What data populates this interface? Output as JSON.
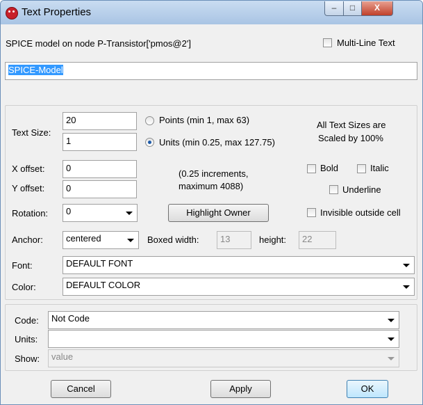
{
  "window": {
    "title": "Text Properties"
  },
  "titlebar": {
    "minimize": "–",
    "maximize": "□",
    "close": "X"
  },
  "header": {
    "description": "SPICE model on node P-Transistor['pmos@2']",
    "multiline_label": "Multi-Line Text"
  },
  "text_value": "SPICE-Model",
  "size": {
    "label": "Text Size:",
    "points_value": "20",
    "units_value": "1",
    "points_label": "Points (min 1, max 63)",
    "units_label": "Units (min 0.25, max 127.75)",
    "note_line1": "All Text Sizes are",
    "note_line2": "Scaled by 100%"
  },
  "offset": {
    "x_label": "X offset:",
    "x_value": "0",
    "y_label": "Y offset:",
    "y_value": "0",
    "note_line1": "(0.25 increments,",
    "note_line2": "maximum 4088)"
  },
  "style": {
    "bold": "Bold",
    "italic": "Italic",
    "underline": "Underline",
    "invisible": "Invisible outside cell"
  },
  "rotation": {
    "label": "Rotation:",
    "value": "0"
  },
  "highlight_button": "Highlight Owner",
  "anchor": {
    "label": "Anchor:",
    "value": "centered"
  },
  "boxed": {
    "width_label": "Boxed width:",
    "width_value": "13",
    "height_label": "height:",
    "height_value": "22"
  },
  "font": {
    "label": "Font:",
    "value": "DEFAULT FONT"
  },
  "color": {
    "label": "Color:",
    "value": "DEFAULT COLOR"
  },
  "code": {
    "label": "Code:",
    "value": "Not Code"
  },
  "units": {
    "label": "Units:",
    "value": ""
  },
  "show": {
    "label": "Show:",
    "value": "value"
  },
  "footer": {
    "cancel": "Cancel",
    "apply": "Apply",
    "ok": "OK"
  }
}
